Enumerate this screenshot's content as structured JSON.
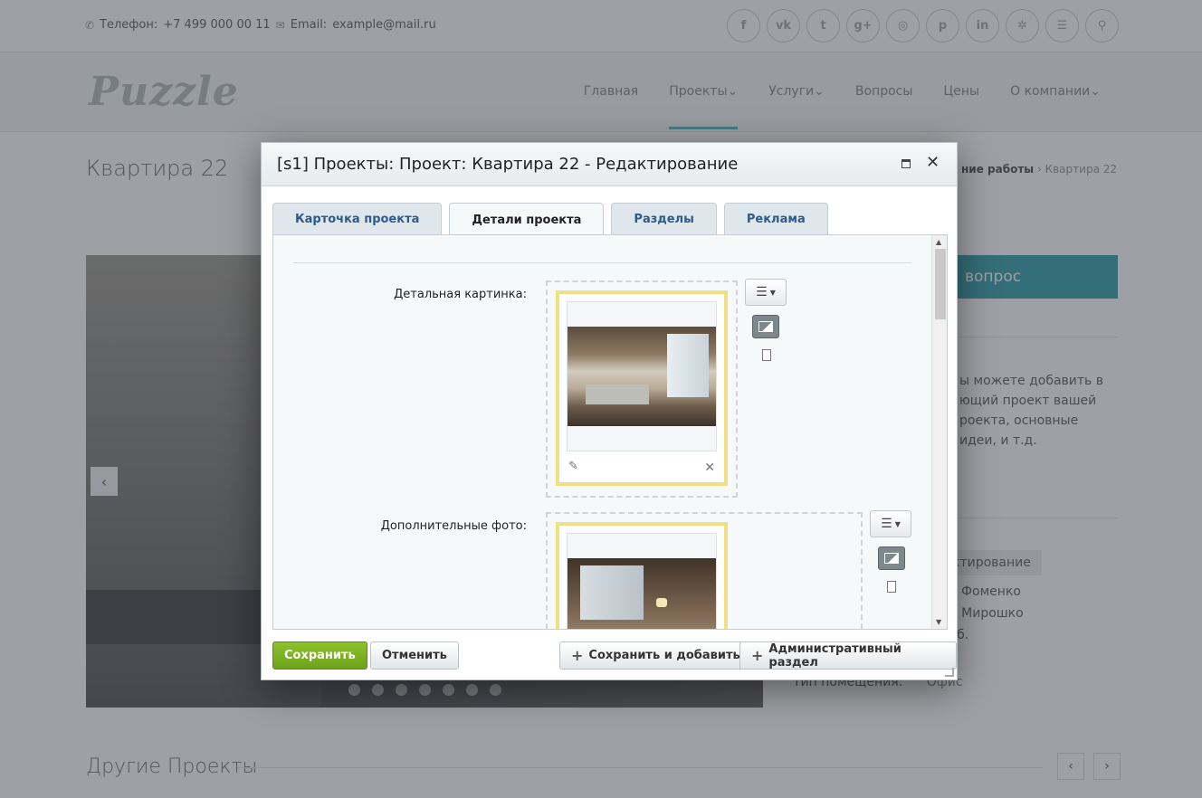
{
  "site": {
    "phone_label": "Телефон:",
    "phone": "+7 499 000 00 11",
    "email_label": "Email:",
    "email": "example@mail.ru",
    "social_icons": [
      "facebook-icon",
      "vk-icon",
      "twitter-icon",
      "googleplus-icon",
      "instagram-icon",
      "pinterest-icon",
      "linkedin-icon",
      "dribbble-icon",
      "rss-icon",
      "search-icon"
    ],
    "social_glyphs": [
      "f",
      "vk",
      "t",
      "g+",
      "◎",
      "p",
      "in",
      "✲",
      "☰",
      "⚲"
    ],
    "logo": "Puzzle",
    "nav": [
      "Главная",
      "Проекты",
      "Услуги",
      "Вопросы",
      "Цены",
      "О компании"
    ],
    "nav_dropdown_marks": [
      "",
      "⌄",
      "⌄",
      "",
      "",
      "⌄"
    ],
    "page_title": "Квартира 22",
    "breadcrumb_current": "Квартира 22",
    "breadcrumb_parent": "ние работы",
    "ask_button": "вопрос",
    "side_text": "ы можете добавить в ющий проект вашей роекта, основные идеи, и т.д.",
    "side_tag": "ктирование",
    "side_line1": "ия Фоменко",
    "side_line2": "на Мирошко",
    "side_line3": "руб.",
    "room_type_label": "Тип помещения:",
    "room_type_value": "Офис",
    "others_title": "Другие Проекты",
    "accent": "#3fa5ad"
  },
  "dialog": {
    "title": "[s1] Проекты: Проект: Квартира 22 - Редактирование",
    "tabs": [
      {
        "label": "Карточка проекта"
      },
      {
        "label": "Детали проекта",
        "active": true
      },
      {
        "label": "Разделы"
      },
      {
        "label": "Реклама"
      }
    ],
    "fields": {
      "detail_picture_label": "Детальная картинка:",
      "extra_photos_label": "Дополнительные фото:"
    },
    "buttons": {
      "save": "Сохранить",
      "cancel": "Отменить",
      "save_and_add": "Сохранить и добавить",
      "admin_section": "Административный раздел"
    },
    "save_color": "#7bb024"
  }
}
